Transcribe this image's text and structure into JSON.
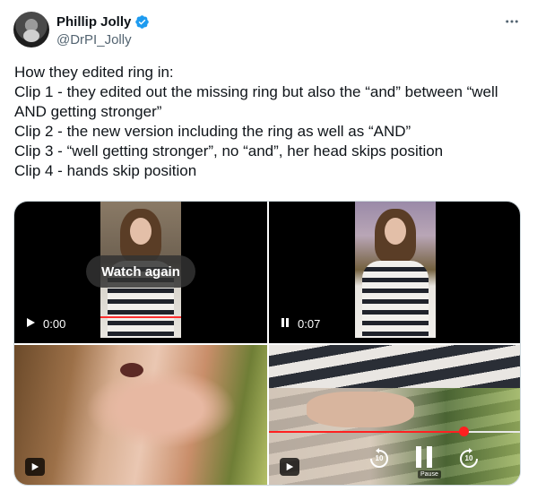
{
  "author": {
    "name": "Phillip Jolly",
    "handle": "@DrPI_Jolly",
    "verified_color": "#1d9bf0"
  },
  "tweet": {
    "lines": [
      "How they edited ring in:",
      "Clip 1 - they edited out the missing ring but also the “and” between “well",
      "AND getting stronger”",
      "Clip 2 - the new version including the ring as well as “AND”",
      "Clip 3 - “well getting stronger”, no “and”, her head skips position",
      "Clip 4 - hands skip position"
    ]
  },
  "media": {
    "clip1": {
      "overlay_button": "Watch again",
      "time": "0:00"
    },
    "clip2": {
      "time": "0:07"
    },
    "clip4": {
      "skip_back": "10",
      "skip_forward": "10",
      "pause_tooltip": "Pause",
      "progress": 0.77
    },
    "accent_progress": "#ff2020"
  },
  "icons": [
    "verified-badge-icon",
    "more-icon",
    "play-icon",
    "pause-icon",
    "rewind-10-icon",
    "forward-10-icon"
  ]
}
